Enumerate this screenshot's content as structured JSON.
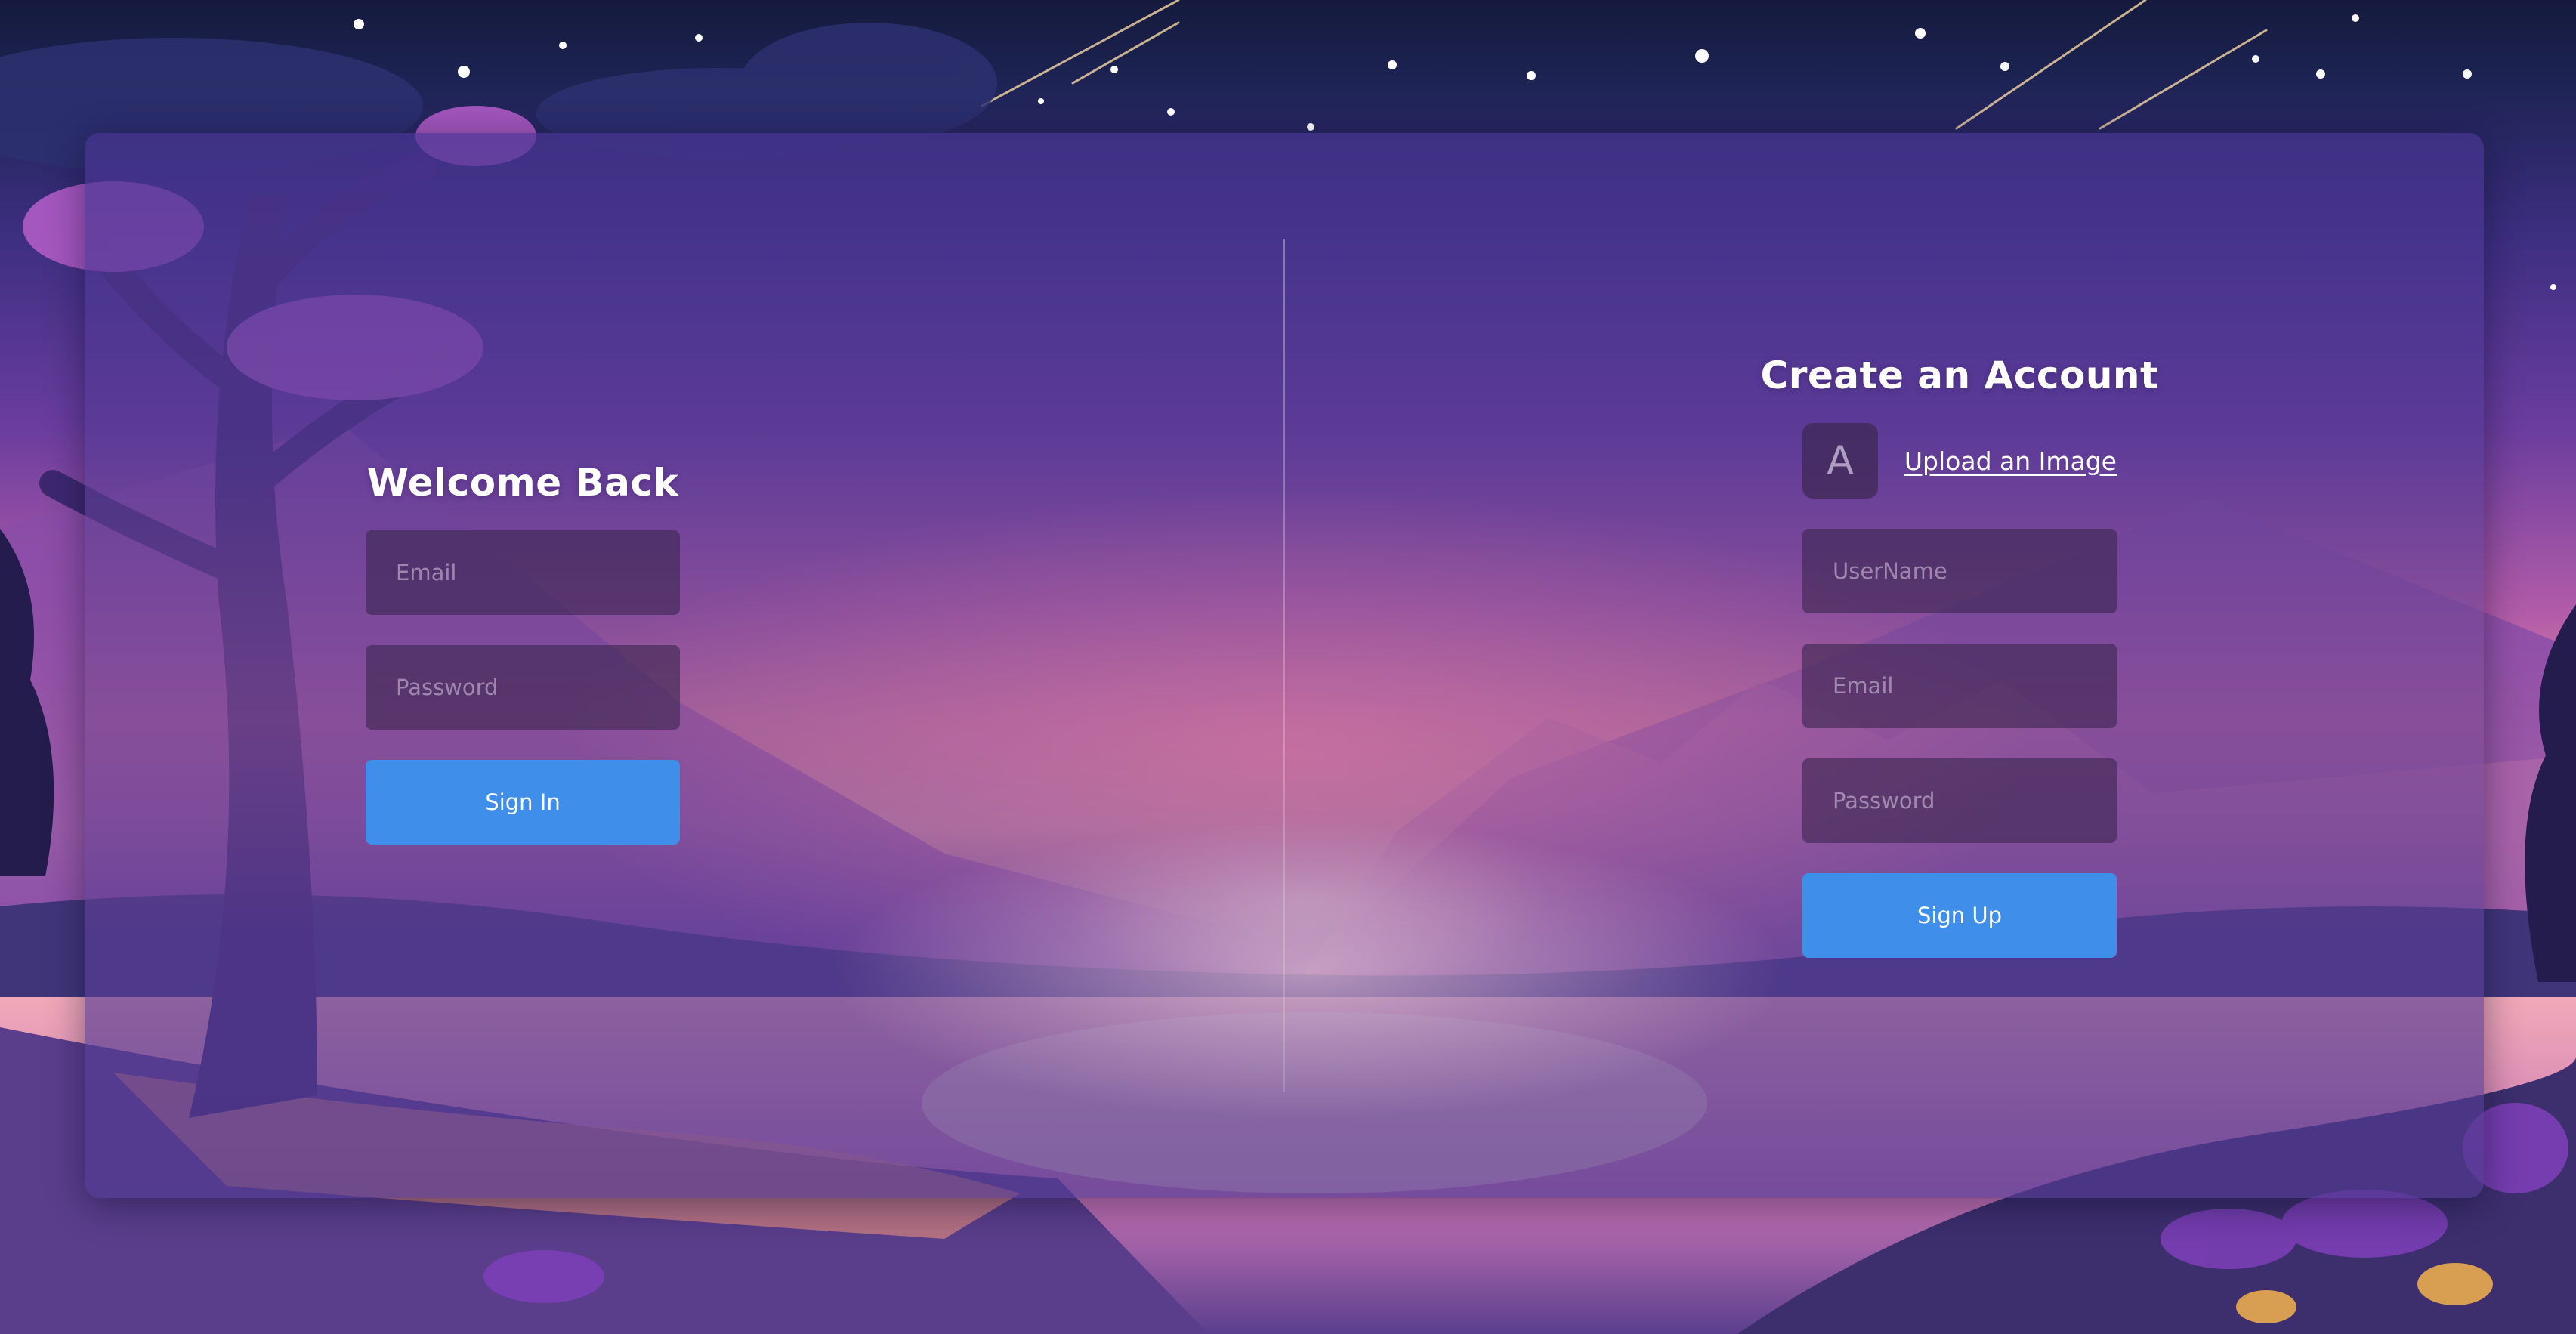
{
  "login": {
    "title": "Welcome Back",
    "email_placeholder": "Email",
    "password_placeholder": "Password",
    "submit_label": "Sign In"
  },
  "signup": {
    "title": "Create an Account",
    "avatar_letter": "A",
    "upload_label": "Upload an Image",
    "username_placeholder": "UserName",
    "email_placeholder": "Email",
    "password_placeholder": "Password",
    "submit_label": "Sign Up"
  },
  "colors": {
    "accent": "#3f8ee9",
    "field_bg": "#3c2650",
    "night_sky": "#151a3d",
    "sunset_pink": "#e88aa1"
  },
  "icons": {
    "avatar": "avatar-initial-icon",
    "background": "night-landscape-illustration"
  }
}
